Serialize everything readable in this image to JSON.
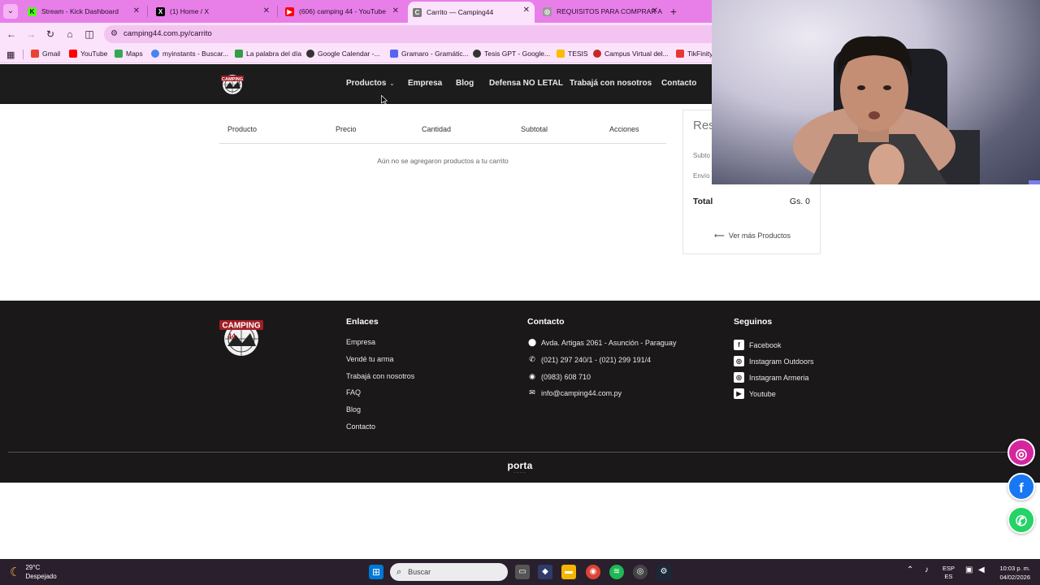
{
  "browser": {
    "tabs": [
      {
        "label": "Stream - Kick Dashboard",
        "favicon": "kick-icon",
        "color": "#53fc18"
      },
      {
        "label": "(1) Home / X",
        "favicon": "x-icon",
        "color": "#000000"
      },
      {
        "label": "(606) camping 44 - YouTube",
        "favicon": "youtube-icon",
        "color": "#ff0000"
      },
      {
        "label": "Carrito — Camping44",
        "favicon": "camping44-icon",
        "color": "#666666"
      },
      {
        "label": "REQUISITOS PARA COMPRAR A",
        "favicon": "globe-icon",
        "color": "#888888"
      }
    ],
    "url": "camping44.com.py/carrito",
    "bookmarks": [
      {
        "label": "Gmail",
        "color": "#ea4335"
      },
      {
        "label": "YouTube",
        "color": "#ff0000"
      },
      {
        "label": "Maps",
        "color": "#34a853"
      },
      {
        "label": "myinstants - Buscar...",
        "color": "#4285f4"
      },
      {
        "label": "La palabra del día",
        "color": "#2f9e44"
      },
      {
        "label": "Google Calendar -...",
        "color": "#333333"
      },
      {
        "label": "Gramaro - Gramátic...",
        "color": "#5865f2"
      },
      {
        "label": "Tesis GPT - Google...",
        "color": "#333333"
      },
      {
        "label": "TESIS",
        "color": "#fbbc04"
      },
      {
        "label": "Campus Virtual del...",
        "color": "#c62828"
      },
      {
        "label": "TikFinity",
        "color": "#e53935"
      }
    ]
  },
  "site": {
    "logo_text": "CAMPING 44",
    "nav": [
      {
        "label": "Productos",
        "has_dropdown": true
      },
      {
        "label": "Empresa"
      },
      {
        "label": "Blog"
      },
      {
        "label": "Defensa NO LETAL"
      },
      {
        "label": "Trabajá con nosotros"
      },
      {
        "label": "Contacto"
      }
    ]
  },
  "cart": {
    "columns": [
      "Producto",
      "Precio",
      "Cantidad",
      "Subtotal",
      "Acciones"
    ],
    "empty_message": "Aún no se agregaron productos a tu carrito"
  },
  "summary": {
    "title": "Res",
    "subtotal_label": "Subto",
    "shipping_label": "Envío",
    "total_label": "Total",
    "total_value": "Gs. 0",
    "more_products": "Ver más Productos"
  },
  "footer": {
    "links_heading": "Enlaces",
    "links": [
      "Empresa",
      "Vendé tu arma",
      "Trabajá con nosotros",
      "FAQ",
      "Blog",
      "Contacto"
    ],
    "contact_heading": "Contacto",
    "contact": [
      {
        "icon": "location-icon",
        "text": "Avda. Artigas 2061 - Asunción - Paraguay"
      },
      {
        "icon": "phone-icon",
        "text": "(021) 297 240/1 - (021) 299 191/4"
      },
      {
        "icon": "whatsapp-icon",
        "text": "(0983) 608 710"
      },
      {
        "icon": "mail-icon",
        "text": "info@camping44.com.py"
      }
    ],
    "social_heading": "Seguinos",
    "social": [
      {
        "icon": "facebook-icon",
        "text": "Facebook"
      },
      {
        "icon": "instagram-icon",
        "text": "Instagram Outdoors"
      },
      {
        "icon": "instagram-icon",
        "text": "Instagram Armeria"
      },
      {
        "icon": "youtube-icon",
        "text": "Youtube"
      }
    ],
    "brand": "porta"
  },
  "floating": [
    {
      "name": "instagram",
      "color": "#d6249f"
    },
    {
      "name": "facebook",
      "color": "#1877f2"
    },
    {
      "name": "whatsapp",
      "color": "#25d366"
    }
  ],
  "taskbar": {
    "temperature": "29°C",
    "weather": "Despejado",
    "search_placeholder": "Buscar",
    "lang_top": "ESP",
    "lang_bottom": "ES",
    "time": "10:03 p. m.",
    "date": "04/02/2026"
  }
}
